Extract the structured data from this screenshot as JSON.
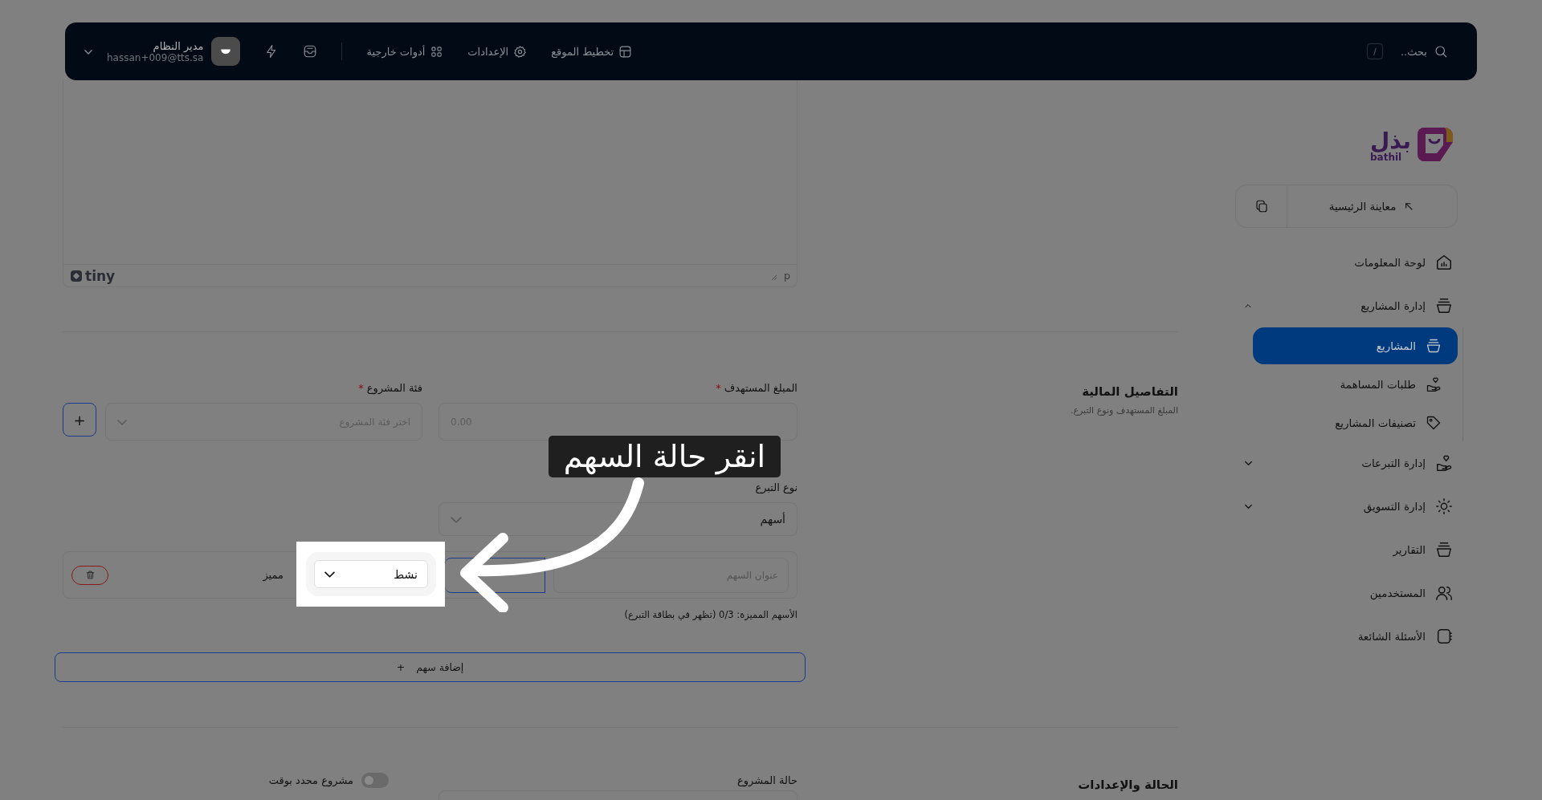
{
  "header": {
    "search": {
      "placeholder": "بحث.."
    },
    "shortcut": "/",
    "nav": [
      {
        "label": "تخطيط الموقع"
      },
      {
        "label": "الإعدادات"
      },
      {
        "label": "أدوات خارجية"
      }
    ],
    "user": {
      "name": "مدير النظام",
      "email": "hassan+009@tts.sa"
    }
  },
  "sidebar": {
    "logo": {
      "arabic": "بذل",
      "latin": "bathil"
    },
    "preview_button": "معاينة الرئيسية",
    "items": [
      {
        "label": "لوحة المعلومات",
        "selected": false
      },
      {
        "label": "إدارة المشاريع",
        "selected": false,
        "expanded": true,
        "children": [
          {
            "label": "المشاريع",
            "selected": true
          },
          {
            "label": "طلبات المساهمة",
            "selected": false
          },
          {
            "label": "تصنيفات المشاريع",
            "selected": false
          }
        ]
      },
      {
        "label": "إدارة التبرعات",
        "selected": false,
        "expanded": false
      },
      {
        "label": "إدارة التسويق",
        "selected": false,
        "expanded": false
      },
      {
        "label": "التقارير",
        "selected": false
      },
      {
        "label": "المستخدمين",
        "selected": false
      },
      {
        "label": "الأسئلة الشائعة",
        "selected": false
      }
    ]
  },
  "editor": {
    "status_path": "p",
    "brand": "tiny"
  },
  "financial": {
    "title": "التفاصيل المالية",
    "subtitle": "المبلغ المستهدف ونوع التبرع.",
    "target_amount": {
      "label": "المبلغ المستهدف",
      "mark": "*",
      "placeholder": "0.00"
    },
    "category": {
      "label": "فئة المشروع",
      "mark": "*",
      "placeholder": "اختر فئة المشروع",
      "add": "+"
    },
    "donation_type": {
      "label": "نوع التبرع",
      "value": "أسهم"
    },
    "shares": [
      {
        "title_placeholder": "عنوان السهم",
        "status": "نشط",
        "featured_label": "مميز"
      }
    ],
    "featured_count": "الأسهم المميزة: 0/3 (تظهر في بطاقة التبرع)",
    "add_share": {
      "icon": "+",
      "label": "إضافة سهم"
    }
  },
  "settings": {
    "title": "الحالة والإعدادات",
    "status_label": "حالة المشروع",
    "timed": {
      "label": "مشروع محدد بوقت",
      "on": false
    }
  },
  "tooltip": {
    "text": "انقر حالة السهم"
  }
}
